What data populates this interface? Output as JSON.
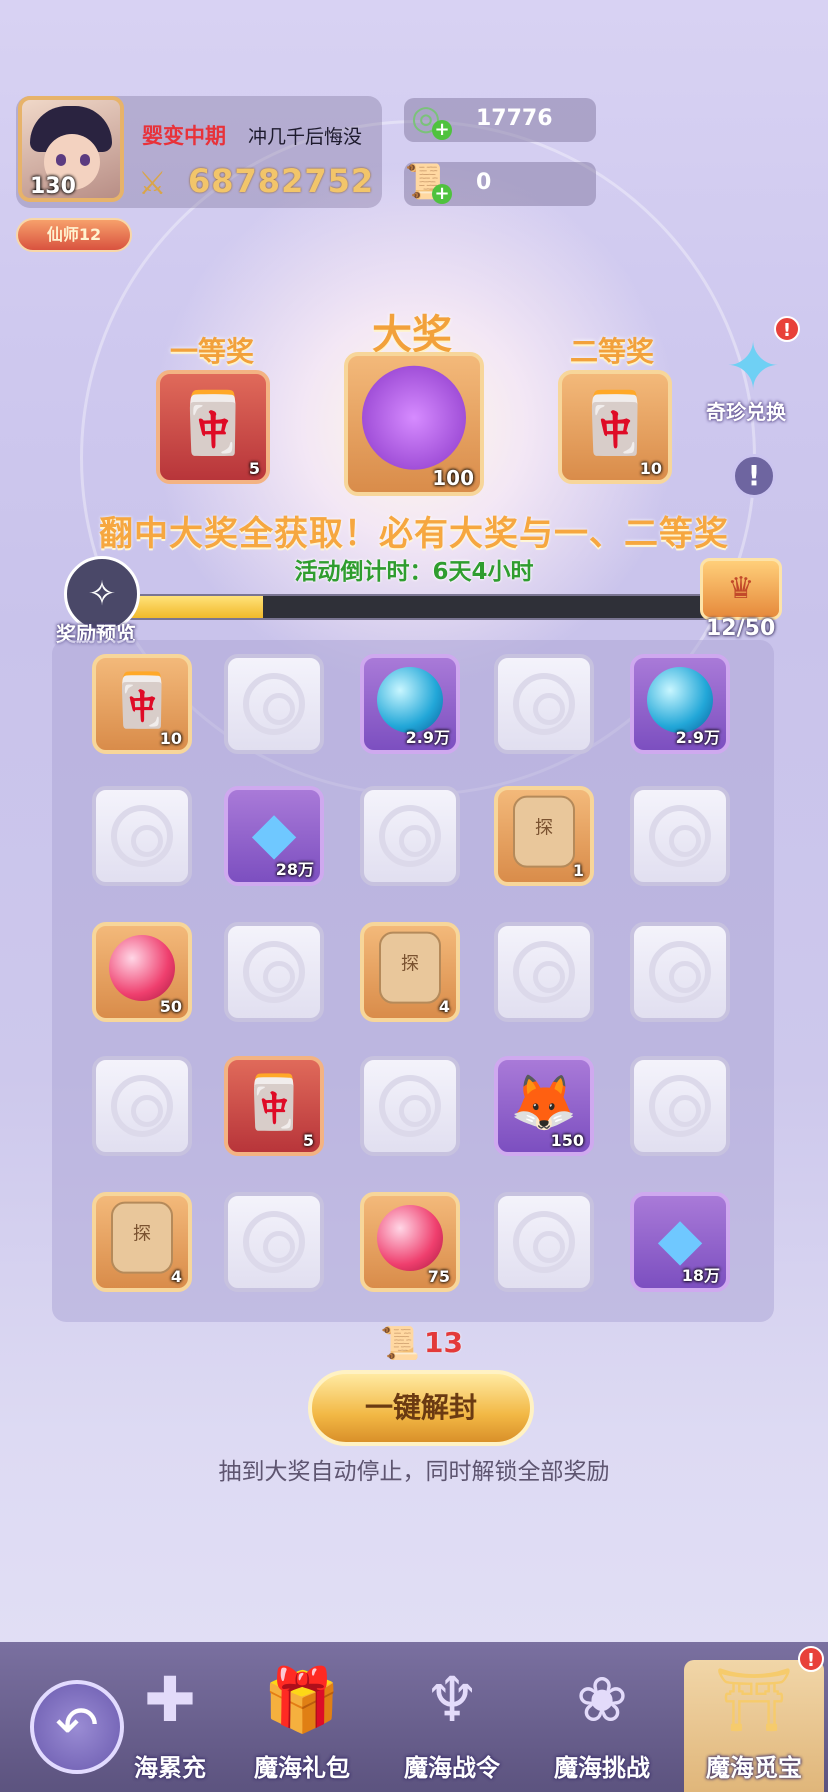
{
  "player": {
    "level": "130",
    "realm": "婴变中期",
    "name": "冲几千后悔没",
    "power": "68782752",
    "title": "仙师12"
  },
  "currencies": [
    {
      "icon": "jade-coin-icon",
      "value": "17776"
    },
    {
      "icon": "scroll-ticket-icon",
      "value": "0"
    }
  ],
  "prizes": {
    "first": {
      "label": "一等奖",
      "qty": "5"
    },
    "grand": {
      "label": "大奖",
      "qty": "100"
    },
    "second": {
      "label": "二等奖",
      "qty": "10"
    }
  },
  "exchange_label": "奇珍兑换",
  "exchange_badge": "!",
  "help_label": "!",
  "headline": "翻中大奖全获取！必有大奖与一、二等奖",
  "countdown": "活动倒计时：6天4小时",
  "reward_preview_label": "奖励预览",
  "progress": {
    "current": 12,
    "total": 50,
    "text": "12/50"
  },
  "grid": [
    [
      {
        "t": "ticket-green",
        "q": "10"
      },
      {
        "t": "empty"
      },
      {
        "t": "orb-blue",
        "q": "2.9万"
      },
      {
        "t": "empty"
      },
      {
        "t": "orb-blue",
        "q": "2.9万"
      }
    ],
    [
      {
        "t": "empty"
      },
      {
        "t": "crystal",
        "q": "28万"
      },
      {
        "t": "empty"
      },
      {
        "t": "token",
        "q": "1"
      },
      {
        "t": "empty"
      }
    ],
    [
      {
        "t": "orb-red",
        "q": "50"
      },
      {
        "t": "empty"
      },
      {
        "t": "token",
        "q": "4"
      },
      {
        "t": "empty"
      },
      {
        "t": "empty"
      }
    ],
    [
      {
        "t": "empty"
      },
      {
        "t": "ticket-red",
        "q": "5"
      },
      {
        "t": "empty"
      },
      {
        "t": "fox",
        "q": "150"
      },
      {
        "t": "empty"
      }
    ],
    [
      {
        "t": "token",
        "q": "4"
      },
      {
        "t": "empty"
      },
      {
        "t": "orb-red",
        "q": "75"
      },
      {
        "t": "empty"
      },
      {
        "t": "crystal",
        "q": "18万"
      }
    ]
  ],
  "ticket_count": "13",
  "unlock_button": "一键解封",
  "note": "抽到大奖自动停止，同时解锁全部奖励",
  "nav": {
    "tabs": [
      "海累充",
      "魔海礼包",
      "魔海战令",
      "魔海挑战",
      "魔海觅宝"
    ],
    "active_index": 4,
    "badge": "!"
  }
}
